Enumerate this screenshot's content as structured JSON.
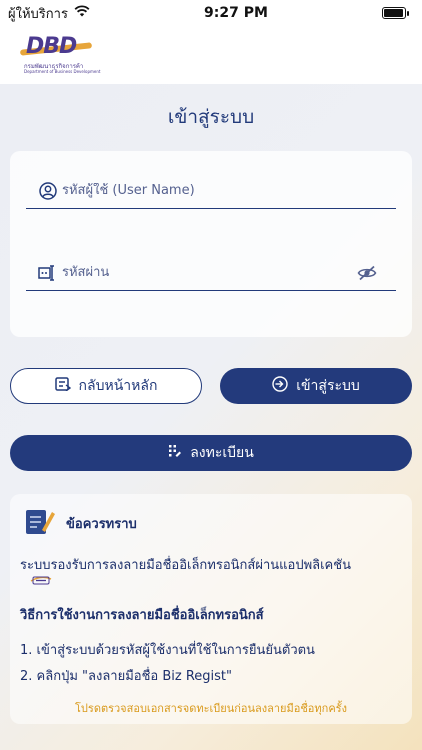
{
  "status_bar": {
    "carrier": "ผู้ให้บริการ",
    "time": "9:27 PM",
    "battery_level": 0.95
  },
  "header": {
    "logo_text": "DBD",
    "logo_subtitle_th": "กรมพัฒนาธุรกิจการค้า",
    "logo_subtitle_en": "Department of Business Development"
  },
  "page": {
    "title": "เข้าสู่ระบบ"
  },
  "login": {
    "username_placeholder": "รหัสผู้ใช้ (User Name)",
    "password_placeholder": "รหัสผ่าน",
    "username_value": "",
    "password_value": ""
  },
  "buttons": {
    "back": "กลับหน้าหลัก",
    "login": "เข้าสู่ระบบ",
    "register": "ลงทะเบียน"
  },
  "info": {
    "title": "ข้อควรทราบ",
    "line1": "ระบบรองรับการลงลายมือชื่ออิเล็กทรอนิกส์ผ่านแอปพลิเคชัน",
    "how_title": "วิธีการใช้งานการลงลายมือชื่ออิเล็กทรอนิกส์",
    "step1": "1. เข้าสู่ระบบด้วยรหัสผู้ใช้งานที่ใช้ในการยืนยันตัวตน",
    "step2": "2. คลิกปุ่ม \"ลงลายมือชื่อ Biz Regist\"",
    "note": "โปรดตรวจสอบเอกสารจดทะเบียนก่อนลงลายมือชื่อทุกครั้ง"
  },
  "colors": {
    "primary": "#233a7c",
    "accent": "#d99a1c",
    "logo_purple": "#4b3a8f",
    "logo_orange": "#e7a53a"
  }
}
